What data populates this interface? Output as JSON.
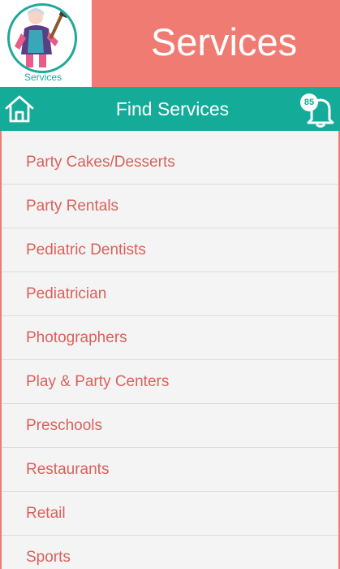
{
  "header": {
    "logo_label": "Services",
    "title": "Services"
  },
  "navbar": {
    "title": "Find Services",
    "notification_count": "85"
  },
  "services": [
    {
      "label": "Party Cakes/Desserts"
    },
    {
      "label": "Party Rentals"
    },
    {
      "label": "Pediatric Dentists"
    },
    {
      "label": "Pediatrician"
    },
    {
      "label": "Photographers"
    },
    {
      "label": "Play & Party Centers"
    },
    {
      "label": "Preschools"
    },
    {
      "label": "Restaurants"
    },
    {
      "label": "Retail"
    },
    {
      "label": "Sports"
    }
  ],
  "colors": {
    "accent_teal": "#15ab99",
    "brand_coral": "#f07b73",
    "item_text": "#d9625b"
  },
  "icons": [
    "home-icon",
    "bell-icon",
    "services-logo"
  ]
}
